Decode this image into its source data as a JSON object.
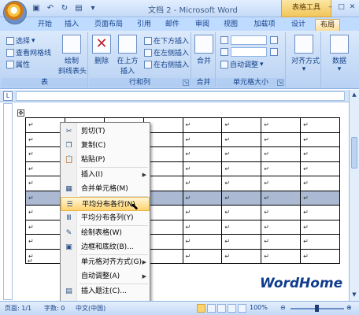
{
  "titlebar": {
    "title": "文档 2 - Microsoft Word",
    "contextual_tab_group": "表格工具",
    "qat_icons": [
      "save-icon",
      "undo-icon",
      "redo-icon",
      "open-icon"
    ]
  },
  "tabs": [
    "开始",
    "插入",
    "页面布局",
    "引用",
    "邮件",
    "审阅",
    "视图",
    "加载项",
    "设计",
    "布局"
  ],
  "active_tab": "布局",
  "ribbon": {
    "table_group": {
      "label": "表",
      "select": "选择",
      "view_gridlines": "查看网格线",
      "properties": "属性",
      "draw_diagonal_line1": "绘制",
      "draw_diagonal_line2": "斜线表头"
    },
    "rows_cols_group": {
      "label": "行和列",
      "delete": "删除",
      "insert_above_line1": "在上方",
      "insert_above_line2": "插入",
      "insert_below": "在下方插入",
      "insert_left": "在左侧插入",
      "insert_right": "在右侧插入"
    },
    "merge_group": {
      "label": "合并",
      "merge": "合并"
    },
    "cell_size_group": {
      "label": "单元格大小",
      "autofit": "自动调整"
    },
    "align_group": {
      "label": "对齐方式"
    },
    "data_group": {
      "label": "数据"
    }
  },
  "document": {
    "cell_mark": "↵",
    "rows": 10,
    "cols": 8,
    "selected_row": 5
  },
  "context_menu": {
    "items": [
      {
        "label": "剪切(T)",
        "icon": "scissors-icon"
      },
      {
        "label": "复制(C)",
        "icon": "copy-icon"
      },
      {
        "label": "粘贴(P)",
        "icon": "paste-icon"
      },
      {
        "label": "插入(I)",
        "icon": "",
        "submenu": true
      },
      {
        "label": "合并单元格(M)",
        "icon": "merge-cells-icon"
      },
      {
        "label": "平均分布各行(N)",
        "icon": "distribute-rows-icon",
        "highlighted": true
      },
      {
        "label": "平均分布各列(Y)",
        "icon": "distribute-columns-icon"
      },
      {
        "label": "绘制表格(W)",
        "icon": "draw-table-icon"
      },
      {
        "label": "边框和底纹(B)...",
        "icon": "borders-shading-icon"
      },
      {
        "label": "单元格对齐方式(G)",
        "icon": "",
        "submenu": true
      },
      {
        "label": "自动调整(A)",
        "icon": "",
        "submenu": true
      },
      {
        "label": "插入题注(C)...",
        "icon": "insert-caption-icon"
      },
      {
        "label": "表格属性(R)...",
        "icon": "table-properties-icon"
      }
    ]
  },
  "statusbar": {
    "page": "页面: 1/1",
    "words": "字数: 0",
    "ime": "中文(中国)",
    "zoom": "100%",
    "zoom_level_percent": 100
  },
  "watermark": "WordHome"
}
